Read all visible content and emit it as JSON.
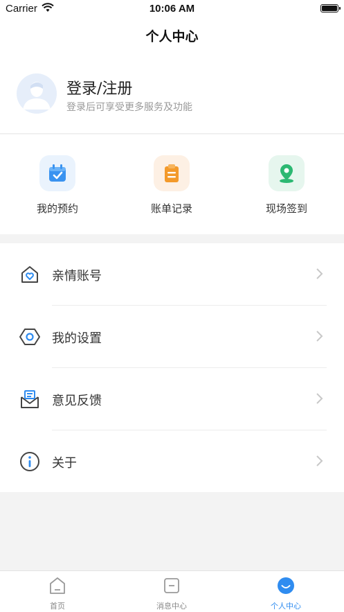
{
  "status_bar": {
    "carrier": "Carrier",
    "time": "10:06 AM"
  },
  "nav": {
    "title": "个人中心"
  },
  "profile": {
    "title": "登录/注册",
    "subtitle": "登录后可享受更多服务及功能"
  },
  "quick_actions": [
    {
      "label": "我的预约",
      "icon": "calendar-check-icon",
      "color": "#3a93f0",
      "bg": "#eaf3fd"
    },
    {
      "label": "账单记录",
      "icon": "clipboard-icon",
      "color": "#f39a2b",
      "bg": "#fdf0e4"
    },
    {
      "label": "现场签到",
      "icon": "location-pin-icon",
      "color": "#2cb872",
      "bg": "#e6f6ee"
    }
  ],
  "menu": [
    {
      "label": "亲情账号",
      "icon": "family-home-icon"
    },
    {
      "label": "我的设置",
      "icon": "settings-hexagon-icon"
    },
    {
      "label": "意见反馈",
      "icon": "feedback-envelope-icon"
    },
    {
      "label": "关于",
      "icon": "info-icon"
    }
  ],
  "tab_bar": {
    "items": [
      {
        "label": "首页",
        "icon": "home-icon",
        "active": false
      },
      {
        "label": "消息中心",
        "icon": "message-icon",
        "active": false
      },
      {
        "label": "个人中心",
        "icon": "profile-icon",
        "active": true
      }
    ],
    "active_color": "#2f8cf0",
    "inactive_color": "#888888"
  }
}
